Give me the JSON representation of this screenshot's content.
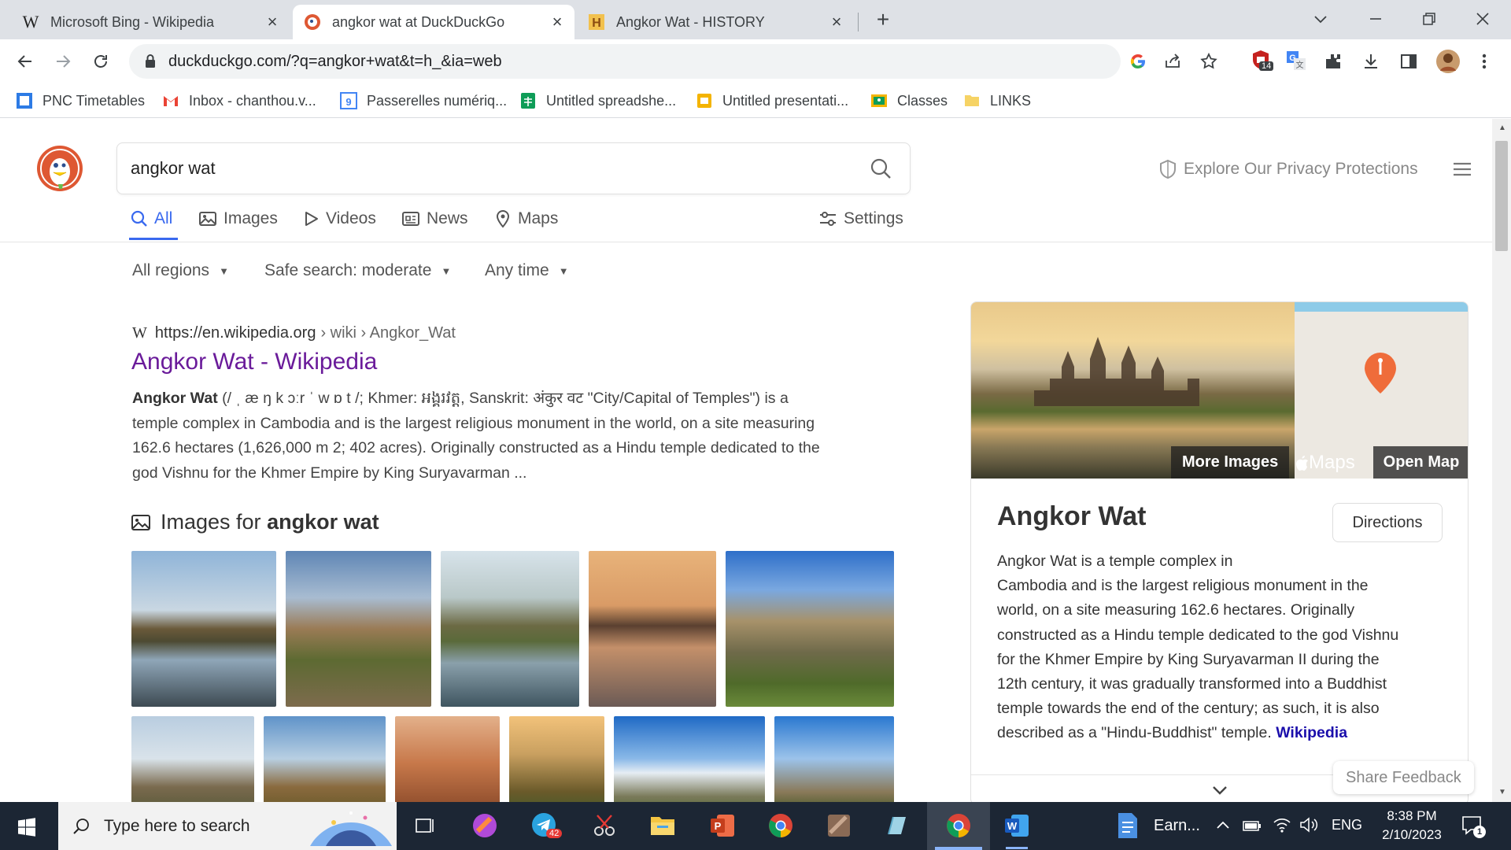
{
  "browser": {
    "tabs": [
      {
        "title": "Microsoft Bing - Wikipedia",
        "favicon": "wikipedia-w-icon",
        "active": false
      },
      {
        "title": "angkor wat at DuckDuckGo",
        "favicon": "duckduckgo-icon",
        "active": true
      },
      {
        "title": "Angkor Wat - HISTORY",
        "favicon": "history-h-icon",
        "active": false
      }
    ],
    "new_tab": "+",
    "url": "duckduckgo.com/?q=angkor+wat&t=h_&ia=web",
    "extension_badge": "14",
    "bookmarks": [
      {
        "label": "PNC Timetables",
        "icon": "pnc-icon",
        "color": "#2d7be5"
      },
      {
        "label": "Inbox - chanthou.v...",
        "icon": "gmail-icon",
        "color": "#ea4335"
      },
      {
        "label": "Passerelles numériq...",
        "icon": "calendar-9-icon",
        "color": "#4285f4"
      },
      {
        "label": "Untitled spreadshe...",
        "icon": "sheets-icon",
        "color": "#0f9d58"
      },
      {
        "label": "Untitled presentati...",
        "icon": "slides-icon",
        "color": "#f4b400"
      },
      {
        "label": "Classes",
        "icon": "classroom-icon",
        "color": "#f4b400"
      },
      {
        "label": "LINKS",
        "icon": "folder-icon",
        "color": "#f6d365"
      }
    ]
  },
  "search": {
    "query": "angkor wat",
    "privacy_link": "Explore Our Privacy Protections",
    "nav": [
      "All",
      "Images",
      "Videos",
      "News",
      "Maps"
    ],
    "settings": "Settings",
    "filters": [
      "All regions",
      "Safe search: moderate",
      "Any time"
    ]
  },
  "result": {
    "domain": "https://en.wikipedia.org",
    "path": "› wiki › Angkor_Wat",
    "title": "Angkor Wat - Wikipedia",
    "snippet_bold": "Angkor Wat",
    "snippet_line1": " (/ ˌ æ ŋ k ɔːr ˈ w ɒ t /; Khmer: អង្គរវត្ត, Sanskrit: अंकुर वट \"City/Capital of Temples\") is a",
    "snippet_line2": "temple complex in Cambodia and is the largest religious monument in the world, on a site measuring",
    "snippet_line3": "162.6 hectares (1,626,000 m 2; 402 acres). Originally constructed as a Hindu temple dedicated to the",
    "snippet_line4": "god Vishnu for the Khmer Empire by King Suryavarman ..."
  },
  "images_section": {
    "prefix": "Images for ",
    "query": "angkor wat"
  },
  "knowledge_panel": {
    "more_images": "More Images",
    "maps_brand": "Maps",
    "open_map": "Open Map",
    "title": "Angkor Wat",
    "directions": "Directions",
    "desc_lines": [
      "Angkor Wat is a temple complex in",
      "Cambodia and is the largest religious monument in the",
      "world, on a site measuring 162.6 hectares. Originally",
      "constructed as a Hindu temple dedicated to the god Vishnu",
      "for the Khmer Empire by King Suryavarman II during the",
      "12th century, it was gradually transformed into a Buddhist",
      "temple towards the end of the century; as such, it is also"
    ],
    "desc_last": "described as a \"Hindu-Buddhist\" temple. ",
    "source_link": "Wikipedia",
    "share_feedback": "Share Feedback"
  },
  "taskbar": {
    "search_placeholder": "Type here to search",
    "telegram_badge": "42",
    "earn_label": "Earn...",
    "language": "ENG",
    "time": "8:38 PM",
    "date": "2/10/2023",
    "notification_badge": "1"
  },
  "colors": {
    "link": "#6a1b9a",
    "accent": "#3969ef",
    "ddg_orange": "#de5833",
    "taskbar": "#1c2634"
  }
}
